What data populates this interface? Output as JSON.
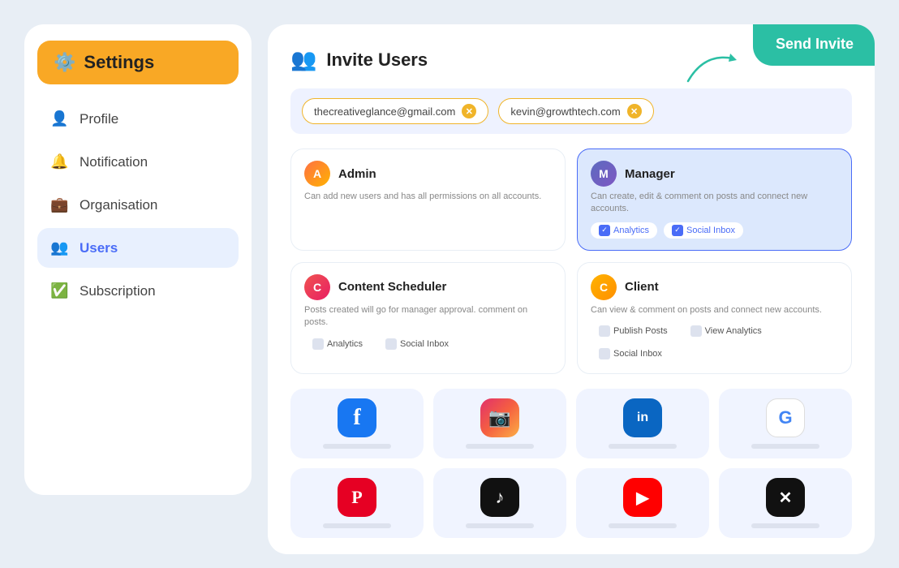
{
  "sidebar": {
    "header": {
      "icon": "⚙️",
      "title": "Settings"
    },
    "items": [
      {
        "id": "profile",
        "icon": "👤",
        "label": "Profile",
        "active": false
      },
      {
        "id": "notification",
        "icon": "🔔",
        "label": "Notification",
        "active": false
      },
      {
        "id": "organisation",
        "icon": "💼",
        "label": "Organisation",
        "active": false
      },
      {
        "id": "users",
        "icon": "👥",
        "label": "Users",
        "active": true
      },
      {
        "id": "subscription",
        "icon": "✅",
        "label": "Subscription",
        "active": false
      }
    ]
  },
  "main": {
    "header": {
      "icon": "👥",
      "title": "Invite Users"
    },
    "send_invite_label": "Send Invite",
    "emails": [
      {
        "address": "thecreativeglance@gmail.com"
      },
      {
        "address": "kevin@growthtech.com"
      }
    ],
    "roles": [
      {
        "id": "admin",
        "name": "Admin",
        "desc": "Can add new users and has all permissions on all accounts.",
        "selected": false,
        "badges": []
      },
      {
        "id": "manager",
        "name": "Manager",
        "desc": "Can create, edit & comment on posts and connect new accounts.",
        "selected": true,
        "badges": [
          {
            "label": "Analytics",
            "checked": true
          },
          {
            "label": "Social Inbox",
            "checked": true
          }
        ]
      },
      {
        "id": "content-scheduler",
        "name": "Content Scheduler",
        "desc": "Posts created will go for manager approval. comment on posts.",
        "selected": false,
        "badges": [
          {
            "label": "Analytics",
            "checked": false
          },
          {
            "label": "Social Inbox",
            "checked": false
          }
        ]
      },
      {
        "id": "client",
        "name": "Client",
        "desc": "Can view & comment on posts and connect new accounts.",
        "selected": false,
        "badges": [
          {
            "label": "Publish Posts",
            "checked": false
          },
          {
            "label": "View Analytics",
            "checked": false
          },
          {
            "label": "Social Inbox",
            "checked": false
          }
        ]
      }
    ],
    "social_accounts": [
      {
        "id": "facebook",
        "icon": "f",
        "class": "fb",
        "label": ""
      },
      {
        "id": "instagram",
        "icon": "📷",
        "class": "ig",
        "label": ""
      },
      {
        "id": "linkedin",
        "icon": "in",
        "class": "li",
        "label": ""
      },
      {
        "id": "google",
        "icon": "G",
        "class": "goog",
        "label": ""
      },
      {
        "id": "pinterest",
        "icon": "P",
        "class": "pi",
        "label": ""
      },
      {
        "id": "tiktok",
        "icon": "♪",
        "class": "tk",
        "label": ""
      },
      {
        "id": "youtube",
        "icon": "▶",
        "class": "yt",
        "label": ""
      },
      {
        "id": "twitter",
        "icon": "✕",
        "class": "tw",
        "label": ""
      }
    ]
  }
}
